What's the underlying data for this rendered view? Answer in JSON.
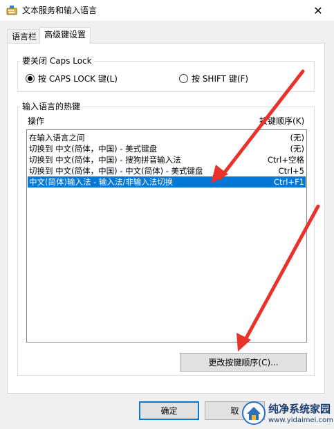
{
  "window": {
    "title": "文本服务和输入语言",
    "close_glyph": "✕"
  },
  "tabs": [
    {
      "label": "语言栏",
      "active": false
    },
    {
      "label": "高级键设置",
      "active": true
    }
  ],
  "caps_lock": {
    "group_label": "要关闭 Caps Lock",
    "options": [
      {
        "label": "按 CAPS LOCK 键(L)",
        "selected": true
      },
      {
        "label": "按 SHIFT 键(F)",
        "selected": false
      }
    ]
  },
  "hotkeys": {
    "group_label": "输入语言的热键",
    "col_action": "操作",
    "col_sequence": "按键顺序(K)",
    "rows": [
      {
        "action": "在输入语言之间",
        "keys": "(无)"
      },
      {
        "action": "切换到 中文(简体，中国) - 美式键盘",
        "keys": "(无)"
      },
      {
        "action": "切换到 中文(简体，中国) - 搜狗拼音输入法",
        "keys": "Ctrl+空格"
      },
      {
        "action": "切换到 中文(简体，中国) - 中文(简体) - 美式键盘",
        "keys": "Ctrl+5"
      },
      {
        "action": "中文(简体)输入法 - 输入法/非输入法切换",
        "keys": "Ctrl+F1",
        "selected": true
      }
    ],
    "change_button": "更改按键顺序(C)..."
  },
  "footer": {
    "ok_label": "确定",
    "cancel_label": "取"
  },
  "watermark": {
    "line1": "纯净系统家园",
    "line2": "www.yidaimei.com"
  },
  "colors": {
    "selection": "#0078d7",
    "arrow": "#e8322c",
    "default_button_border": "#0078d7"
  }
}
